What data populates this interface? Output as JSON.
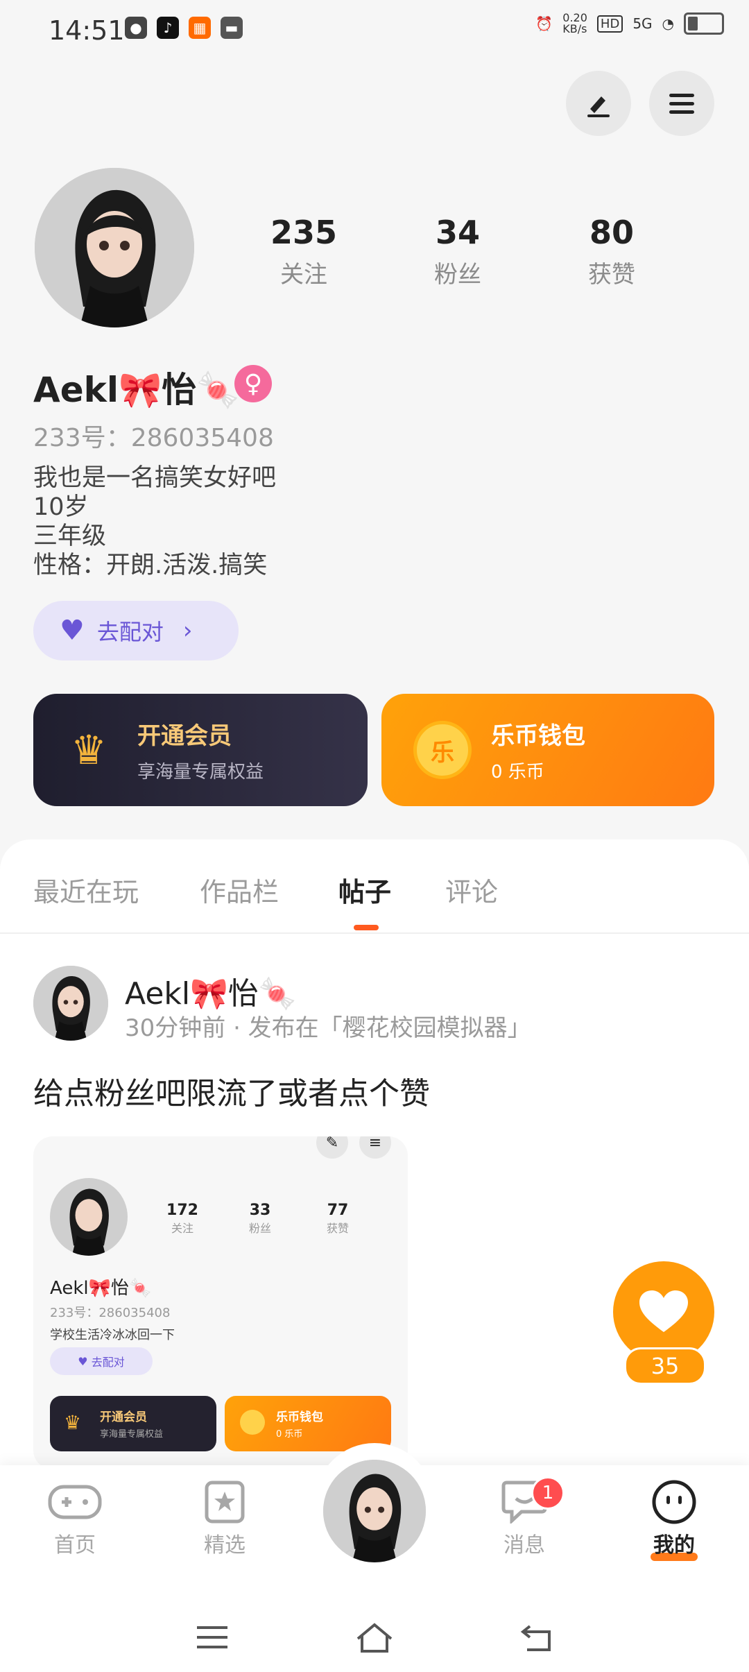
{
  "status_bar": {
    "time": "14:51",
    "net_speed": "0.20\nKB/s",
    "hd": "HD",
    "signal": "5G",
    "apps": [
      "wechat-icon",
      "tiktok-icon",
      "app-orange-icon",
      "app-grey-icon"
    ]
  },
  "header": {
    "edit_icon": "pencil-icon",
    "menu_icon": "menu-icon"
  },
  "profile": {
    "stats": [
      {
        "value": "235",
        "label": "关注"
      },
      {
        "value": "34",
        "label": "粉丝"
      },
      {
        "value": "80",
        "label": "获赞"
      }
    ],
    "username": "Aekl🎀怡🍬",
    "gender_symbol": "♀",
    "uid": "233号：286035408",
    "bio": [
      "我也是一名搞笑女好吧",
      "10岁",
      "三年级",
      "性格：开朗.活泼.搞笑"
    ],
    "match_label": "去配对"
  },
  "cards": {
    "vip_title": "开通会员",
    "vip_sub": "享海量专属权益",
    "wallet_title": "乐币钱包",
    "wallet_sub": "0 乐币",
    "wallet_coin": "乐"
  },
  "tabs": [
    {
      "label": "最近在玩"
    },
    {
      "label": "作品栏"
    },
    {
      "label": "帖子"
    },
    {
      "label": "评论"
    }
  ],
  "active_tab": "帖子",
  "post": {
    "author": "Aekl🎀怡🍬",
    "meta": "30分钟前 · 发布在「樱花校园模拟器」",
    "text": "给点粉丝吧限流了或者点个赞",
    "like_count": "35"
  },
  "preview": {
    "stats": [
      {
        "value": "172",
        "label": "关注"
      },
      {
        "value": "33",
        "label": "粉丝"
      },
      {
        "value": "77",
        "label": "获赞"
      }
    ],
    "username": "Aekl🎀怡🍬",
    "uid": "233号：286035408",
    "bio": "学校生活冷冰冰回一下",
    "match_label": "去配对",
    "vip_title": "开通会员",
    "vip_sub": "享海量专属权益",
    "wallet_title": "乐币钱包",
    "wallet_sub": "0 乐币"
  },
  "bottom_nav": {
    "home": "首页",
    "featured": "精选",
    "messages": "消息",
    "messages_badge": "1",
    "mine": "我的"
  },
  "colors": {
    "accent": "#ff9b0a",
    "tab_indicator": "#ff5a1f",
    "match_purple": "#6a56d6"
  }
}
